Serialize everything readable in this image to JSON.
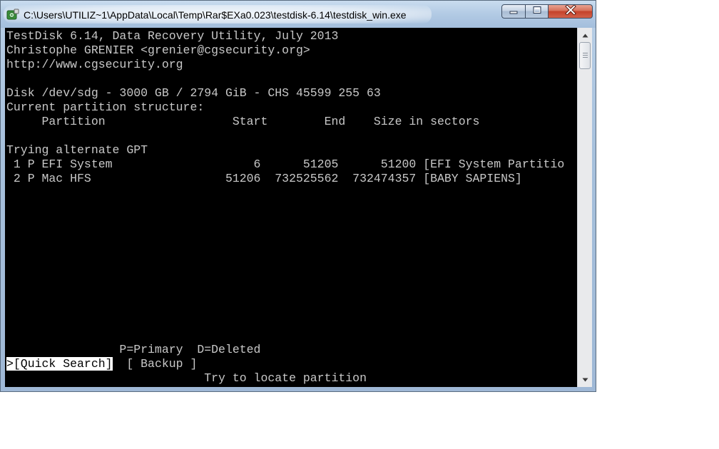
{
  "window": {
    "title": "C:\\Users\\UTILIZ~1\\AppData\\Local\\Temp\\Rar$EXa0.023\\testdisk-6.14\\testdisk_win.exe"
  },
  "console": {
    "lines": [
      "TestDisk 6.14, Data Recovery Utility, July 2013",
      "Christophe GRENIER <grenier@cgsecurity.org>",
      "http://www.cgsecurity.org",
      "",
      "Disk /dev/sdg - 3000 GB / 2794 GiB - CHS 45599 255 63",
      "Current partition structure:",
      "     Partition                  Start        End    Size in sectors",
      "",
      "Trying alternate GPT",
      " 1 P EFI System                    6      51205      51200 [EFI System Partitio",
      " 2 P Mac HFS                   51206  732525562  732474357 [BABY SAPIENS]"
    ],
    "legend": "                P=Primary  D=Deleted",
    "menu": {
      "quick_search": ">[Quick Search]",
      "backup": "[ Backup ]"
    },
    "hint": "                            Try to locate partition"
  },
  "icons": {
    "app": "testdisk-app-icon",
    "minimize": "minimize-icon",
    "maximize": "maximize-icon",
    "close": "close-icon",
    "scroll_up": "scroll-up-arrow-icon",
    "scroll_down": "scroll-down-arrow-icon"
  }
}
